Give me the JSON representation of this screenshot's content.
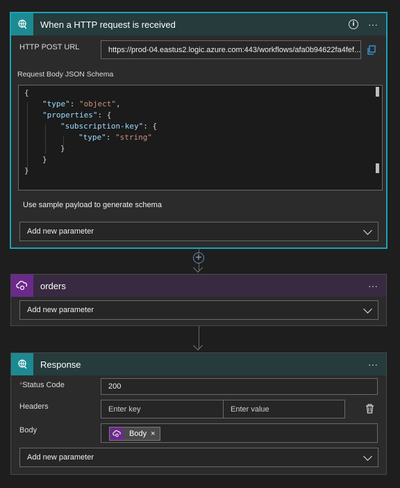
{
  "trigger": {
    "title": "When a HTTP request is received",
    "http_post_url_label": "HTTP POST URL",
    "http_post_url_value": "https://prod-04.eastus2.logic.azure.com:443/workflows/afa0b94622fa4fef...",
    "schema_label": "Request Body JSON Schema",
    "schema_lines": [
      {
        "indent": 0,
        "parts": [
          {
            "t": "p",
            "v": "{"
          }
        ]
      },
      {
        "indent": 1,
        "parts": [
          {
            "t": "k",
            "v": "\"type\""
          },
          {
            "t": "p",
            "v": ": "
          },
          {
            "t": "s",
            "v": "\"object\""
          },
          {
            "t": "p",
            "v": ","
          }
        ]
      },
      {
        "indent": 1,
        "parts": [
          {
            "t": "k",
            "v": "\"properties\""
          },
          {
            "t": "p",
            "v": ": {"
          }
        ]
      },
      {
        "indent": 2,
        "parts": [
          {
            "t": "k",
            "v": "\"subscription-key\""
          },
          {
            "t": "p",
            "v": ": {"
          }
        ]
      },
      {
        "indent": 3,
        "parts": [
          {
            "t": "k",
            "v": "\"type\""
          },
          {
            "t": "p",
            "v": ": "
          },
          {
            "t": "s",
            "v": "\"string\""
          }
        ]
      },
      {
        "indent": 2,
        "parts": [
          {
            "t": "p",
            "v": "}"
          }
        ]
      },
      {
        "indent": 1,
        "parts": [
          {
            "t": "p",
            "v": "}"
          }
        ]
      },
      {
        "indent": 0,
        "parts": [
          {
            "t": "p",
            "v": "}"
          }
        ]
      }
    ],
    "sample_payload_link": "Use sample payload to generate schema",
    "add_param_label": "Add new parameter"
  },
  "orders": {
    "title": "orders",
    "add_param_label": "Add new parameter"
  },
  "response": {
    "title": "Response",
    "status_code_required_mark": "*",
    "status_code_label": "Status Code",
    "status_code_value": "200",
    "headers_label": "Headers",
    "header_key_placeholder": "Enter key",
    "header_value_placeholder": "Enter value",
    "body_label": "Body",
    "body_token_label": "Body",
    "body_token_remove": "×",
    "add_param_label": "Add new parameter"
  },
  "menu_glyph": "···",
  "info_glyph": "i",
  "add_step_glyph": "+",
  "colors": {
    "trigger_accent": "#1d8a91",
    "connector_accent": "#6b2a8a",
    "selected_border": "#1aa3b8"
  },
  "icons": {
    "trigger": "globe-request-icon",
    "orders": "cloud-connector-icon",
    "response": "globe-request-icon",
    "copy": "copy-icon",
    "delete": "trash-icon",
    "chevron": "chevron-down-icon"
  }
}
